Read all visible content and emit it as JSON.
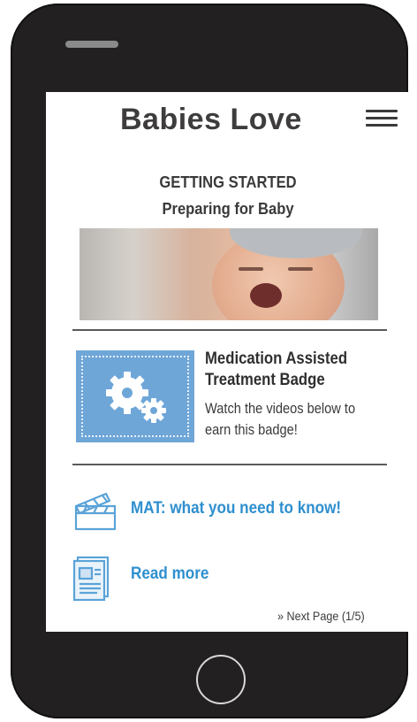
{
  "app": {
    "title": "Babies Love"
  },
  "header": {
    "menu_icon": "hamburger-menu-icon"
  },
  "intro": {
    "section": "GETTING STARTED",
    "topic": "Preparing for Baby"
  },
  "badge": {
    "title": "Medication Assisted Treatment Badge",
    "description": "Watch the videos below to earn this badge!",
    "icon": "gears-icon",
    "tile_color": "#6fa6d8"
  },
  "links": [
    {
      "label": "MAT: what you need to know!",
      "icon": "clapperboard-icon"
    },
    {
      "label": "Read more",
      "icon": "document-icon"
    }
  ],
  "pagination": {
    "label": "» Next Page (1/5)"
  },
  "colors": {
    "link": "#2e8fcf",
    "device_body": "#232021",
    "accent_tile": "#6fa6d8"
  }
}
